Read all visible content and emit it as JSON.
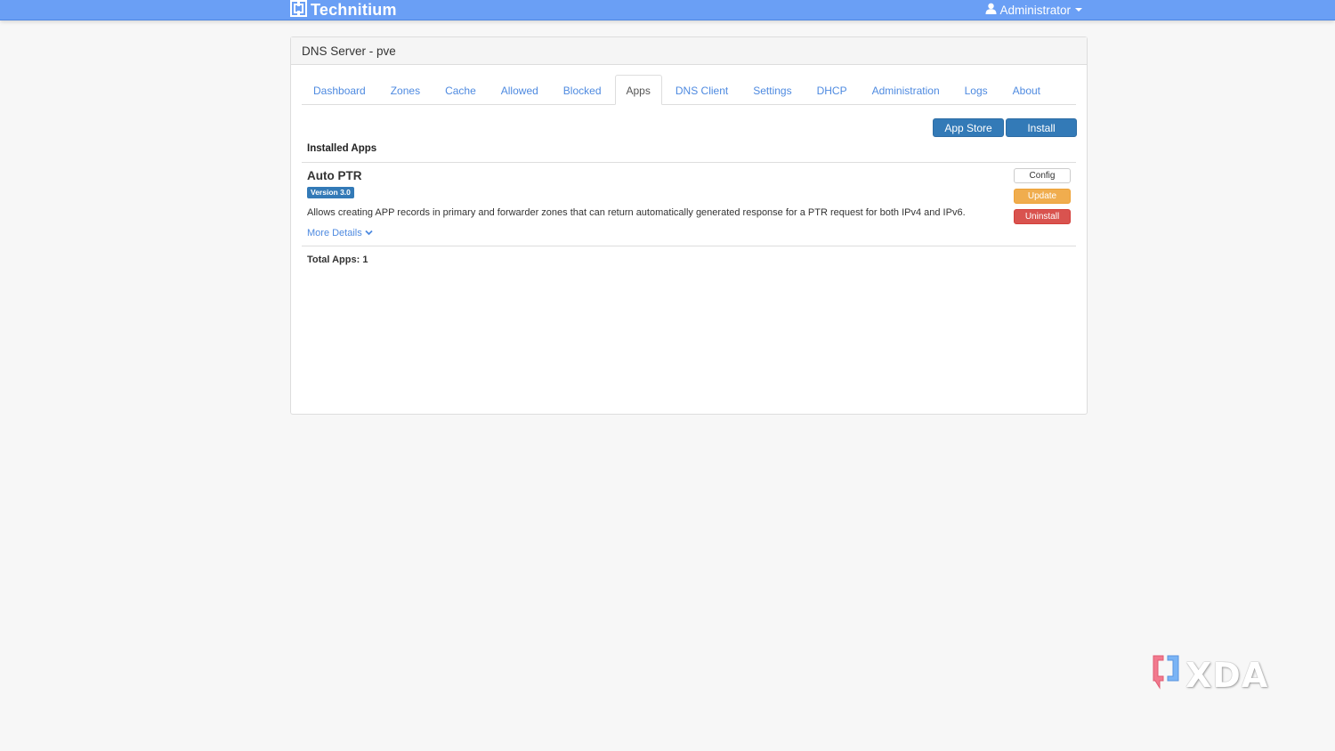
{
  "navbar": {
    "brand": "Technitium",
    "brand_icon": "technitium-logo-icon",
    "user": "Administrator",
    "user_icon": "user-icon",
    "bg_color": "#6a9ff5"
  },
  "panel": {
    "title": "DNS Server - pve"
  },
  "tabs": [
    {
      "label": "Dashboard",
      "active": false
    },
    {
      "label": "Zones",
      "active": false
    },
    {
      "label": "Cache",
      "active": false
    },
    {
      "label": "Allowed",
      "active": false
    },
    {
      "label": "Blocked",
      "active": false
    },
    {
      "label": "Apps",
      "active": true
    },
    {
      "label": "DNS Client",
      "active": false
    },
    {
      "label": "Settings",
      "active": false
    },
    {
      "label": "DHCP",
      "active": false
    },
    {
      "label": "Administration",
      "active": false
    },
    {
      "label": "Logs",
      "active": false
    },
    {
      "label": "About",
      "active": false
    }
  ],
  "toolbar": {
    "app_store_label": "App Store",
    "install_label": "Install"
  },
  "installed_apps": {
    "title": "Installed Apps",
    "apps": [
      {
        "name": "Auto PTR",
        "version": "Version 3.0",
        "description": "Allows creating APP records in primary and forwarder zones that can return automatically generated response for a PTR request for both IPv4 and IPv6.",
        "more_details": "More Details",
        "config_label": "Config",
        "update_label": "Update",
        "uninstall_label": "Uninstall"
      }
    ],
    "total": "Total Apps: 1"
  },
  "watermark": {
    "text": "XDA",
    "icon": "xda-logo-icon"
  }
}
